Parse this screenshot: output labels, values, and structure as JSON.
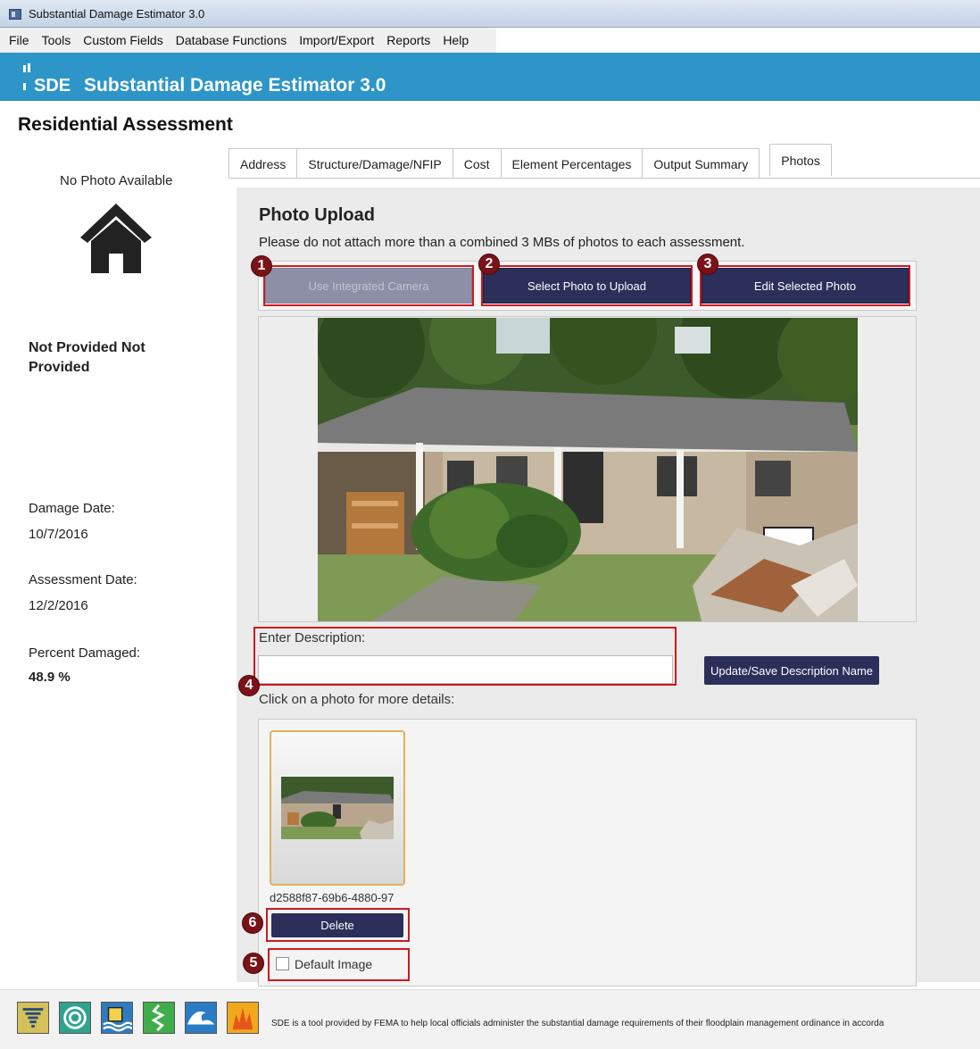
{
  "window": {
    "title": "Substantial Damage Estimator 3.0"
  },
  "menu": [
    "File",
    "Tools",
    "Custom Fields",
    "Database Functions",
    "Import/Export",
    "Reports",
    "Help"
  ],
  "brand": {
    "logo": "SDE",
    "title": "Substantial Damage Estimator 3.0"
  },
  "page_title": "Residential Assessment",
  "left": {
    "no_photo": "No Photo Available",
    "owner": "Not Provided Not Provided",
    "damage_date_label": "Damage Date:",
    "damage_date": "10/7/2016",
    "assessment_date_label": "Assessment Date:",
    "assessment_date": "12/2/2016",
    "percent_damaged_label": "Percent Damaged:",
    "percent_damaged": "48.9 %"
  },
  "tabs": [
    "Address",
    "Structure/Damage/NFIP",
    "Cost",
    "Element Percentages",
    "Output Summary",
    "Photos"
  ],
  "active_tab": "Photos",
  "photos": {
    "heading": "Photo Upload",
    "notice": "Please do not attach more than a combined 3 MBs of photos to each assessment.",
    "use_camera": "Use Integrated Camera",
    "select_photo": "Select Photo to Upload",
    "edit_photo": "Edit Selected Photo",
    "desc_label": "Enter Description:",
    "desc_value": "",
    "update_btn": "Update/Save Description Name",
    "click_label": "Click on a photo for more details:",
    "thumb_name": "d2588f87-69b6-4880-97",
    "delete_btn": "Delete",
    "default_image": "Default Image",
    "default_checked": false
  },
  "markers": [
    "1",
    "2",
    "3",
    "4",
    "5",
    "6"
  ],
  "footer": {
    "icons": [
      "tornado-icon",
      "hurricane-icon",
      "flood-icon",
      "earthquake-icon",
      "tsunami-icon",
      "wildfire-icon"
    ],
    "text": "SDE is a tool provided by FEMA to help local officials administer the substantial damage requirements of their floodplain management ordinance in accorda"
  },
  "colors": {
    "brand_blue": "#2d95c8",
    "button_navy": "#2b2f5a",
    "annotation_red": "#d0191f"
  }
}
